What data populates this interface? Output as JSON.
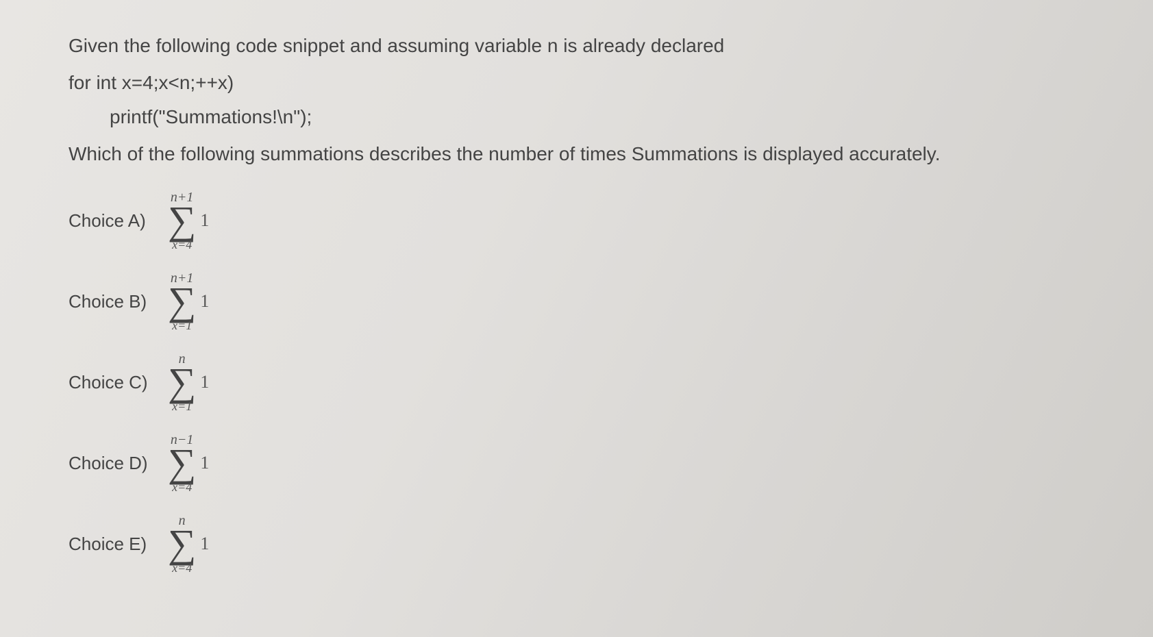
{
  "question": {
    "intro": "Given the following code snippet and assuming variable n is already declared",
    "code_line1": "for int x=4;x<n;++x)",
    "code_line2": "printf(\"Summations!\\n\");",
    "prompt": "Which of the following summations describes the number of times Summations is displayed accurately."
  },
  "choices": [
    {
      "label": "Choice A)",
      "upper": "n+1",
      "lower": "x=4",
      "body": "1"
    },
    {
      "label": "Choice B)",
      "upper": "n+1",
      "lower": "x=1",
      "body": "1"
    },
    {
      "label": "Choice C)",
      "upper": "n",
      "lower": "x=1",
      "body": "1"
    },
    {
      "label": "Choice D)",
      "upper": "n−1",
      "lower": "x=4",
      "body": "1"
    },
    {
      "label": "Choice E)",
      "upper": "n",
      "lower": "x=4",
      "body": "1"
    }
  ]
}
